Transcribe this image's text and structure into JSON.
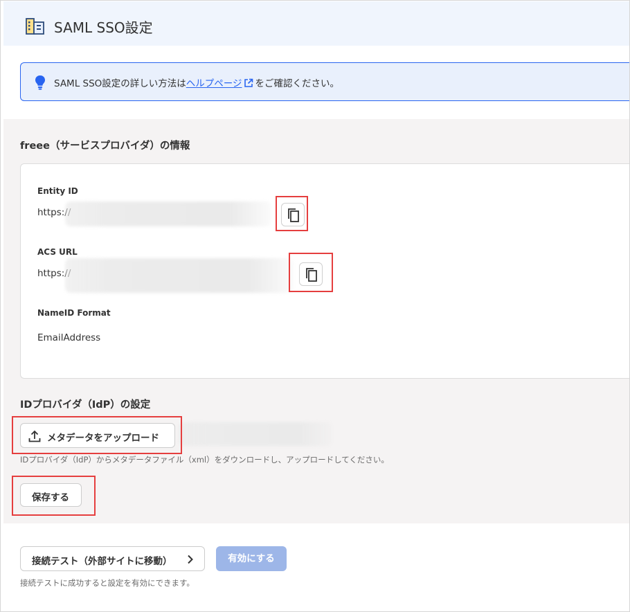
{
  "header": {
    "title": "SAML SSO設定",
    "icon": "building-settings-icon"
  },
  "info_banner": {
    "text_before": "SAML SSO設定の詳しい方法は",
    "link_text": "ヘルプページ",
    "text_after": "をご確認ください。",
    "icon": "lightbulb-icon"
  },
  "sp_section": {
    "title": "freee（サービスプロバイダ）の情報",
    "entity_id": {
      "label": "Entity ID",
      "value": "https://"
    },
    "acs_url": {
      "label": "ACS URL",
      "value": "https://"
    },
    "nameid_format": {
      "label": "NameID Format",
      "value": "EmailAddress"
    }
  },
  "idp_section": {
    "title": "IDプロバイダ（IdP）の設定",
    "upload_button": "メタデータをアップロード",
    "upload_hint": "IDプロバイダ（IdP）からメタデータファイル（xml）をダウンロードし、アップロードしてください。",
    "save_button": "保存する"
  },
  "footer": {
    "test_button": "接続テスト（外部サイトに移動）",
    "enable_button": "有効にする",
    "hint": "接続テストに成功すると設定を有効にできます。"
  },
  "colors": {
    "accent": "#2864f0",
    "highlight": "#e53e3e",
    "disabled": "#9db6e8"
  }
}
